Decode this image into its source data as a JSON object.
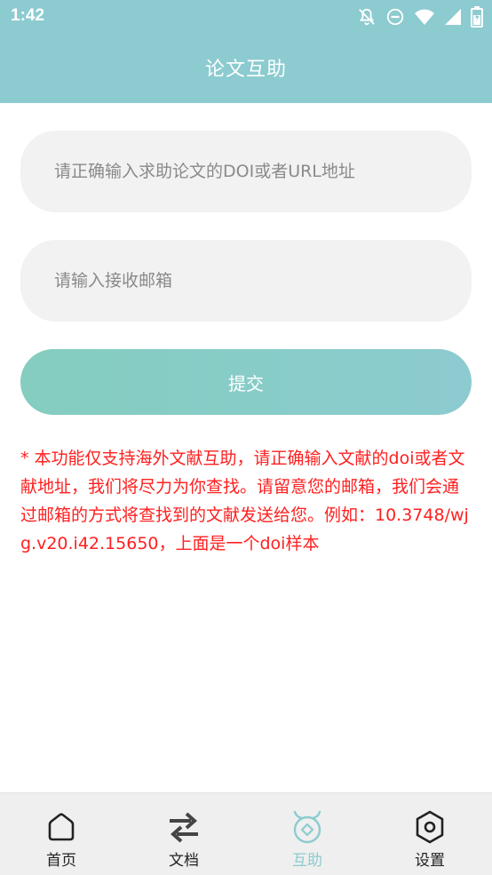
{
  "status": {
    "time": "1:42",
    "icons": [
      "bell-off-icon",
      "do-not-disturb-icon",
      "wifi-icon",
      "signal-icon",
      "battery-icon"
    ]
  },
  "header": {
    "title": "论文互助",
    "background": "#8ccbd0"
  },
  "form": {
    "doi_placeholder": "请正确输入求助论文的DOI或者URL地址",
    "doi_value": "",
    "email_placeholder": "请输入接收邮箱",
    "email_value": "",
    "submit_label": "提交"
  },
  "notice": "* 本功能仅支持海外文献互助，请正确输入文献的doi或者文献地址，我们将尽力为你查找。请留意您的邮箱，我们会通过邮箱的方式将查找到的文献发送给您。例如：10.3748/wjg.v20.i42.15650，上面是一个doi样本",
  "colors": {
    "accent": "#8ccbd0",
    "notice": "#ff2020",
    "field_bg": "#f2f2f2",
    "nav_bg": "#efefef"
  },
  "bottom_nav": {
    "active": "help",
    "items": [
      {
        "label": "首页",
        "icon": "home-icon"
      },
      {
        "label": "文档",
        "icon": "swap-icon"
      },
      {
        "label": "互助",
        "icon": "mutual-help-icon"
      },
      {
        "label": "设置",
        "icon": "hexagon-settings-icon"
      }
    ]
  }
}
